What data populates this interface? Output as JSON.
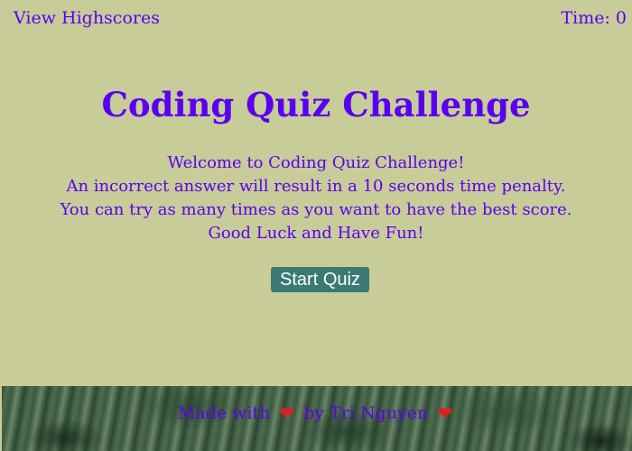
{
  "header": {
    "view_highscores_label": "View Highscores",
    "timer_text": "Time: 0"
  },
  "main": {
    "title": "Coding Quiz Challenge",
    "intro_lines": [
      "Welcome to Coding Quiz Challenge!",
      "An incorrect answer will result in a 10 seconds time penalty.",
      "You can try as many times as you want to have the best score.",
      "Good Luck and Have Fun!"
    ],
    "start_button_label": "Start Quiz"
  },
  "footer": {
    "made_with": "Made with",
    "by_author": "by Tri Nguyen",
    "heart_icon": "heart-icon",
    "heart_glyph": "❤"
  },
  "colors": {
    "background": "#c8cc98",
    "text_accent": "#5a00f0",
    "button_bg": "#3a7a74",
    "button_text": "#ffffff",
    "heart": "#e02020"
  }
}
